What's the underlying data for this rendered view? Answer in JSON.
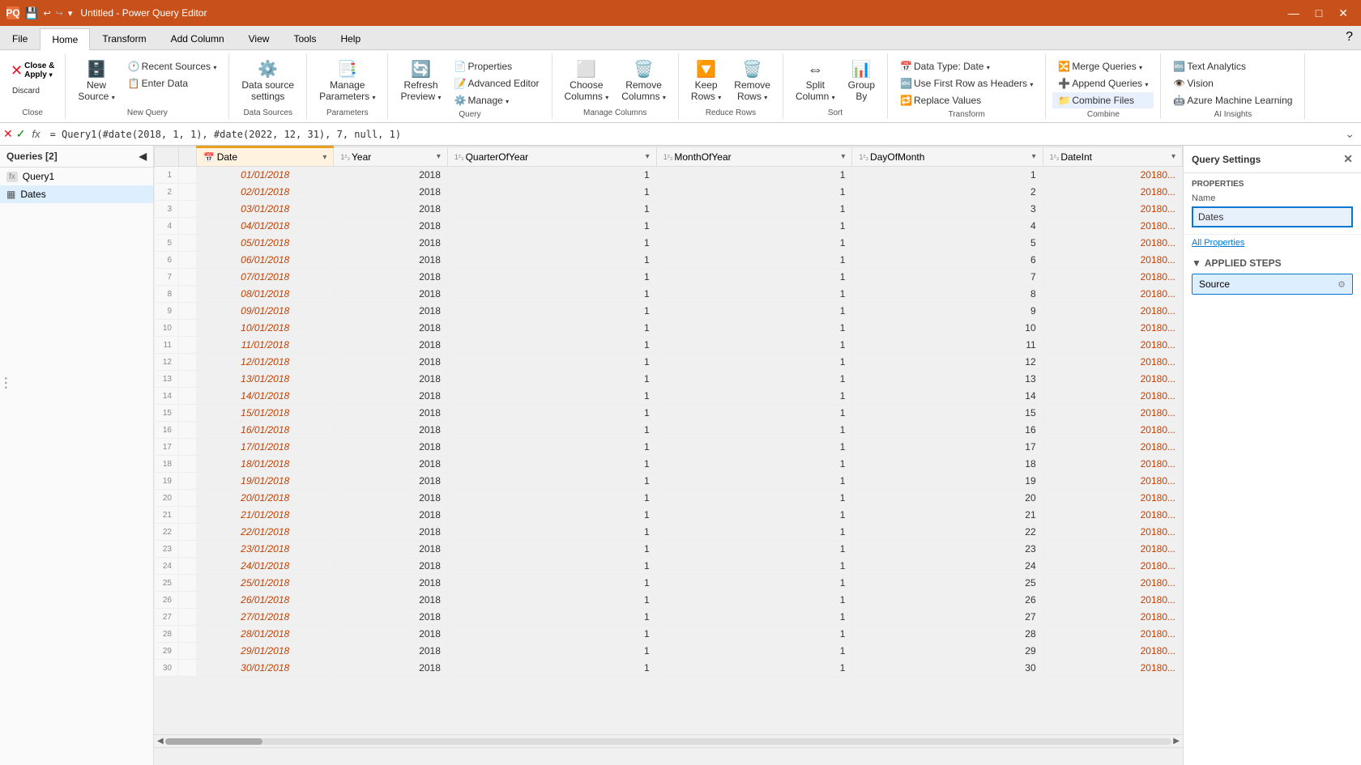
{
  "titleBar": {
    "title": "Untitled - Power Query Editor",
    "icon": "PQ",
    "minimizeBtn": "—",
    "maximizeBtn": "□",
    "closeBtn": "✕"
  },
  "ribbonTabs": [
    {
      "id": "file",
      "label": "File",
      "active": false
    },
    {
      "id": "home",
      "label": "Home",
      "active": true
    },
    {
      "id": "transform",
      "label": "Transform",
      "active": false
    },
    {
      "id": "addcolumn",
      "label": "Add Column",
      "active": false
    },
    {
      "id": "view",
      "label": "View",
      "active": false
    },
    {
      "id": "tools",
      "label": "Tools",
      "active": false
    },
    {
      "id": "help",
      "label": "Help",
      "active": false
    }
  ],
  "ribbonGroups": {
    "close": {
      "label": "Close",
      "closeApply": "Close & Apply",
      "closeApplyArrow": "▾",
      "closeIcon": "✕",
      "discardBtn": "Discard"
    },
    "newQuery": {
      "label": "New Query",
      "newSourceBtn": "New Source",
      "recentSourcesBtn": "Recent Sources",
      "enterDataBtn": "Enter Data"
    },
    "dataSources": {
      "label": "Data Sources",
      "dataSourceSettingsBtn": "Data source settings"
    },
    "parameters": {
      "label": "Parameters",
      "manageParametersBtn": "Manage Parameters"
    },
    "query": {
      "label": "Query",
      "refreshPreviewBtn": "Refresh Preview",
      "propertiesBtn": "Properties",
      "advancedEditorBtn": "Advanced Editor",
      "manageBtn": "Manage"
    },
    "manageColumns": {
      "label": "Manage Columns",
      "chooseColumnsBtn": "Choose Columns",
      "removeColumnsBtn": "Remove Columns"
    },
    "reduceRows": {
      "label": "Reduce Rows",
      "keepRowsBtn": "Keep Rows",
      "removeRowsBtn": "Remove Rows"
    },
    "sort": {
      "label": "Sort",
      "splitColumnBtn": "Split Column",
      "groupByBtn": "Group By"
    },
    "transform": {
      "label": "Transform",
      "dataTypeBtn": "Data Type: Date",
      "useFirstRowBtn": "Use First Row as Headers",
      "replaceValuesBtn": "Replace Values"
    },
    "combine": {
      "label": "Combine",
      "mergeQueriesBtn": "Merge Queries",
      "appendQueriesBtn": "Append Queries",
      "combineFilesBtn": "Combine Files"
    },
    "aiInsights": {
      "label": "AI Insights",
      "textAnalyticsBtn": "Text Analytics",
      "visionBtn": "Vision",
      "azureMLBtn": "Azure Machine Learning"
    }
  },
  "formulaBar": {
    "cancelIcon": "✕",
    "applyIcon": "✓",
    "fxLabel": "fx",
    "formula": "= Query1(#date(2018, 1, 1), #date(2022, 12, 31), 7, null, 1)"
  },
  "queriesPanel": {
    "header": "Queries [2]",
    "collapseIcon": "◀",
    "queries": [
      {
        "id": "query1",
        "name": "Query1",
        "type": "fx",
        "active": false
      },
      {
        "id": "dates",
        "name": "Dates",
        "type": "table",
        "active": true
      }
    ]
  },
  "tableHeaders": [
    {
      "id": "row-num",
      "label": "",
      "type": ""
    },
    {
      "id": "row-selector",
      "label": "",
      "type": ""
    },
    {
      "id": "date",
      "label": "Date",
      "type": "Date",
      "isDate": true
    },
    {
      "id": "year",
      "label": "Year",
      "type": "123"
    },
    {
      "id": "quarterofyear",
      "label": "QuarterOfYear",
      "type": "123"
    },
    {
      "id": "monthofyear",
      "label": "MonthOfYear",
      "type": "123"
    },
    {
      "id": "dayofmonth",
      "label": "DayOfMonth",
      "type": "123"
    },
    {
      "id": "dateid",
      "label": "DateInt",
      "type": "123"
    }
  ],
  "tableRows": [
    {
      "num": 1,
      "date": "01/01/2018",
      "year": 2018,
      "quarter": 1,
      "month": 1,
      "day": 1,
      "dateInt": "20180..."
    },
    {
      "num": 2,
      "date": "02/01/2018",
      "year": 2018,
      "quarter": 1,
      "month": 1,
      "day": 2,
      "dateInt": "20180..."
    },
    {
      "num": 3,
      "date": "03/01/2018",
      "year": 2018,
      "quarter": 1,
      "month": 1,
      "day": 3,
      "dateInt": "20180..."
    },
    {
      "num": 4,
      "date": "04/01/2018",
      "year": 2018,
      "quarter": 1,
      "month": 1,
      "day": 4,
      "dateInt": "20180..."
    },
    {
      "num": 5,
      "date": "05/01/2018",
      "year": 2018,
      "quarter": 1,
      "month": 1,
      "day": 5,
      "dateInt": "20180..."
    },
    {
      "num": 6,
      "date": "06/01/2018",
      "year": 2018,
      "quarter": 1,
      "month": 1,
      "day": 6,
      "dateInt": "20180..."
    },
    {
      "num": 7,
      "date": "07/01/2018",
      "year": 2018,
      "quarter": 1,
      "month": 1,
      "day": 7,
      "dateInt": "20180..."
    },
    {
      "num": 8,
      "date": "08/01/2018",
      "year": 2018,
      "quarter": 1,
      "month": 1,
      "day": 8,
      "dateInt": "20180..."
    },
    {
      "num": 9,
      "date": "09/01/2018",
      "year": 2018,
      "quarter": 1,
      "month": 1,
      "day": 9,
      "dateInt": "20180..."
    },
    {
      "num": 10,
      "date": "10/01/2018",
      "year": 2018,
      "quarter": 1,
      "month": 1,
      "day": 10,
      "dateInt": "20180..."
    },
    {
      "num": 11,
      "date": "11/01/2018",
      "year": 2018,
      "quarter": 1,
      "month": 1,
      "day": 11,
      "dateInt": "20180..."
    },
    {
      "num": 12,
      "date": "12/01/2018",
      "year": 2018,
      "quarter": 1,
      "month": 1,
      "day": 12,
      "dateInt": "20180..."
    },
    {
      "num": 13,
      "date": "13/01/2018",
      "year": 2018,
      "quarter": 1,
      "month": 1,
      "day": 13,
      "dateInt": "20180..."
    },
    {
      "num": 14,
      "date": "14/01/2018",
      "year": 2018,
      "quarter": 1,
      "month": 1,
      "day": 14,
      "dateInt": "20180..."
    },
    {
      "num": 15,
      "date": "15/01/2018",
      "year": 2018,
      "quarter": 1,
      "month": 1,
      "day": 15,
      "dateInt": "20180..."
    },
    {
      "num": 16,
      "date": "16/01/2018",
      "year": 2018,
      "quarter": 1,
      "month": 1,
      "day": 16,
      "dateInt": "20180..."
    },
    {
      "num": 17,
      "date": "17/01/2018",
      "year": 2018,
      "quarter": 1,
      "month": 1,
      "day": 17,
      "dateInt": "20180..."
    },
    {
      "num": 18,
      "date": "18/01/2018",
      "year": 2018,
      "quarter": 1,
      "month": 1,
      "day": 18,
      "dateInt": "20180..."
    },
    {
      "num": 19,
      "date": "19/01/2018",
      "year": 2018,
      "quarter": 1,
      "month": 1,
      "day": 19,
      "dateInt": "20180..."
    },
    {
      "num": 20,
      "date": "20/01/2018",
      "year": 2018,
      "quarter": 1,
      "month": 1,
      "day": 20,
      "dateInt": "20180..."
    },
    {
      "num": 21,
      "date": "21/01/2018",
      "year": 2018,
      "quarter": 1,
      "month": 1,
      "day": 21,
      "dateInt": "20180..."
    },
    {
      "num": 22,
      "date": "22/01/2018",
      "year": 2018,
      "quarter": 1,
      "month": 1,
      "day": 22,
      "dateInt": "20180..."
    },
    {
      "num": 23,
      "date": "23/01/2018",
      "year": 2018,
      "quarter": 1,
      "month": 1,
      "day": 23,
      "dateInt": "20180..."
    },
    {
      "num": 24,
      "date": "24/01/2018",
      "year": 2018,
      "quarter": 1,
      "month": 1,
      "day": 24,
      "dateInt": "20180..."
    },
    {
      "num": 25,
      "date": "25/01/2018",
      "year": 2018,
      "quarter": 1,
      "month": 1,
      "day": 25,
      "dateInt": "20180..."
    },
    {
      "num": 26,
      "date": "26/01/2018",
      "year": 2018,
      "quarter": 1,
      "month": 1,
      "day": 26,
      "dateInt": "20180..."
    },
    {
      "num": 27,
      "date": "27/01/2018",
      "year": 2018,
      "quarter": 1,
      "month": 1,
      "day": 27,
      "dateInt": "20180..."
    },
    {
      "num": 28,
      "date": "28/01/2018",
      "year": 2018,
      "quarter": 1,
      "month": 1,
      "day": 28,
      "dateInt": "20180..."
    },
    {
      "num": 29,
      "date": "29/01/2018",
      "year": 2018,
      "quarter": 1,
      "month": 1,
      "day": 29,
      "dateInt": "20180..."
    },
    {
      "num": 30,
      "date": "30/01/2018",
      "year": 2018,
      "quarter": 1,
      "month": 1,
      "day": 30,
      "dateInt": "20180..."
    }
  ],
  "querySettings": {
    "title": "Query Settings",
    "closeBtn": "✕",
    "propertiesLabel": "PROPERTIES",
    "nameLabel": "Name",
    "nameValue": "Dates",
    "allPropertiesLink": "All Properties",
    "appliedStepsLabel": "APPLIED STEPS",
    "steps": [
      {
        "id": "source",
        "label": "Source",
        "hasGear": true,
        "active": true
      }
    ]
  },
  "statusBar": {
    "text": ""
  }
}
